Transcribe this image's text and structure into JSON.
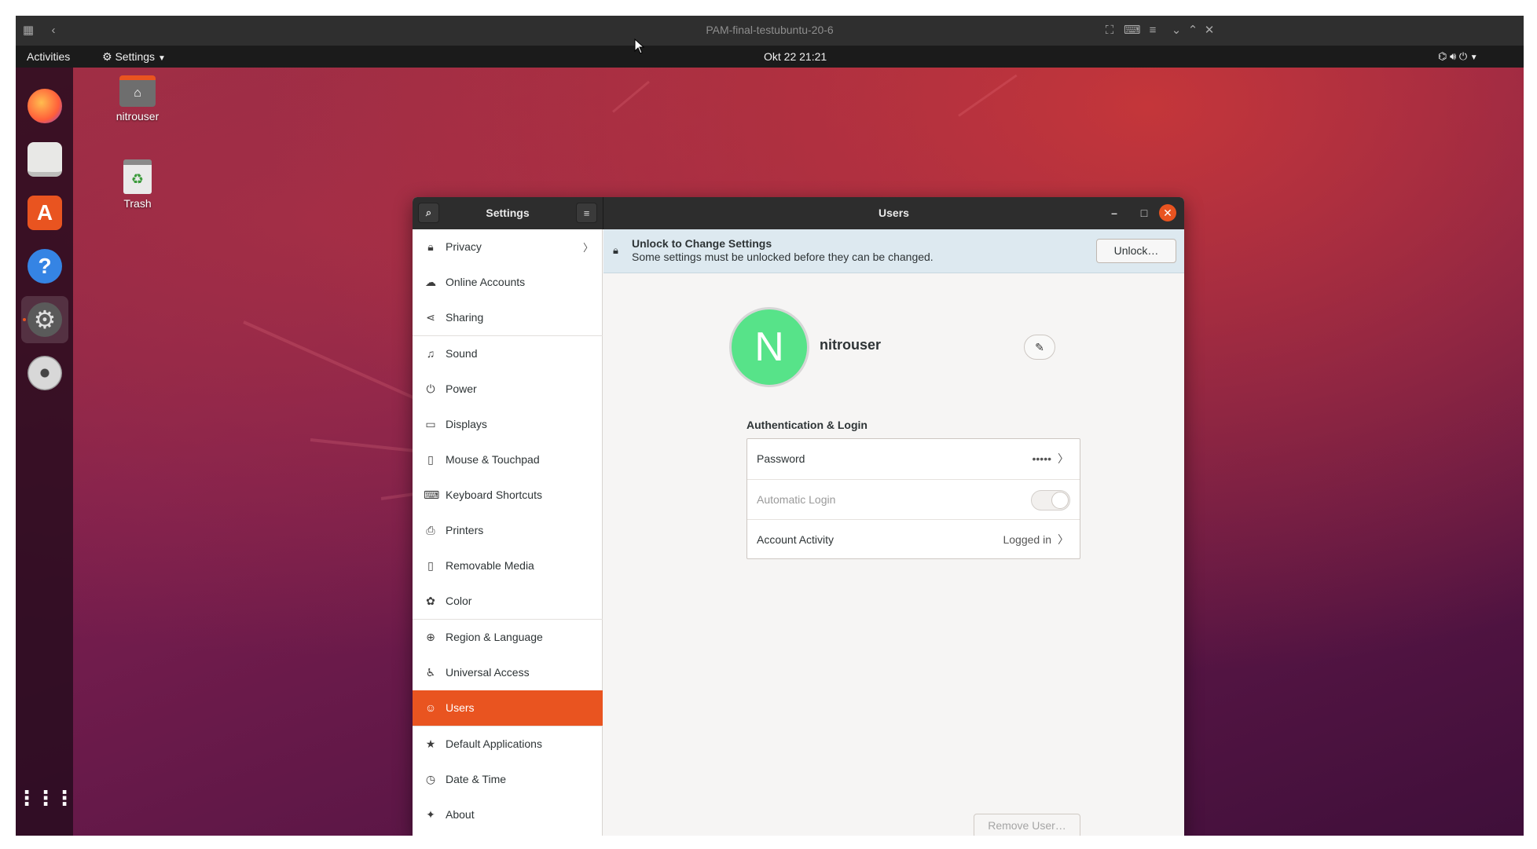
{
  "viewer": {
    "title": "PAM-final-testubuntu-20-6"
  },
  "top_bar": {
    "activities": "Activities",
    "app_menu": "Settings",
    "datetime": "Okt 22  21:21"
  },
  "desktop_icons": [
    {
      "label": "nitrouser",
      "icon": "home-folder-icon"
    },
    {
      "label": "Trash",
      "icon": "trash-icon"
    }
  ],
  "dock": [
    {
      "name": "firefox-icon",
      "color": "#ff7139"
    },
    {
      "name": "files-icon",
      "color": "#f2f2f2"
    },
    {
      "name": "software-icon",
      "color": "#e95420"
    },
    {
      "name": "help-icon",
      "color": "#3584e4"
    },
    {
      "name": "settings-icon",
      "color": "#9a9a9a"
    },
    {
      "name": "dvd-icon",
      "color": "#d0d0d0"
    }
  ],
  "window": {
    "sidebar_title": "Settings",
    "content_title": "Users"
  },
  "sidebar": {
    "items": [
      {
        "label": "Privacy",
        "icon": "lock-icon",
        "chevron": true
      },
      {
        "label": "Online Accounts",
        "icon": "cloud-icon"
      },
      {
        "label": "Sharing",
        "icon": "share-icon"
      },
      {
        "label": "Sound",
        "icon": "music-note-icon"
      },
      {
        "label": "Power",
        "icon": "power-icon"
      },
      {
        "label": "Displays",
        "icon": "display-icon"
      },
      {
        "label": "Mouse & Touchpad",
        "icon": "mouse-icon"
      },
      {
        "label": "Keyboard Shortcuts",
        "icon": "keyboard-icon"
      },
      {
        "label": "Printers",
        "icon": "printer-icon"
      },
      {
        "label": "Removable Media",
        "icon": "usb-drive-icon"
      },
      {
        "label": "Color",
        "icon": "color-icon"
      },
      {
        "label": "Region & Language",
        "icon": "globe-icon"
      },
      {
        "label": "Universal Access",
        "icon": "accessibility-icon"
      },
      {
        "label": "Users",
        "icon": "users-icon",
        "active": true
      },
      {
        "label": "Default Applications",
        "icon": "star-icon"
      },
      {
        "label": "Date & Time",
        "icon": "clock-icon"
      },
      {
        "label": "About",
        "icon": "sparkle-icon"
      }
    ]
  },
  "unlock": {
    "title": "Unlock to Change Settings",
    "subtitle": "Some settings must be unlocked before they can be changed.",
    "button": "Unlock…"
  },
  "user": {
    "initial": "N",
    "name": "nitrouser",
    "avatar_color": "#57e389"
  },
  "auth": {
    "heading": "Authentication & Login",
    "password_label": "Password",
    "password_value": "•••••",
    "auto_login_label": "Automatic Login",
    "auto_login_enabled": false,
    "activity_label": "Account Activity",
    "activity_value": "Logged in"
  },
  "remove_user": "Remove User…",
  "colors": {
    "accent": "#e95420"
  }
}
